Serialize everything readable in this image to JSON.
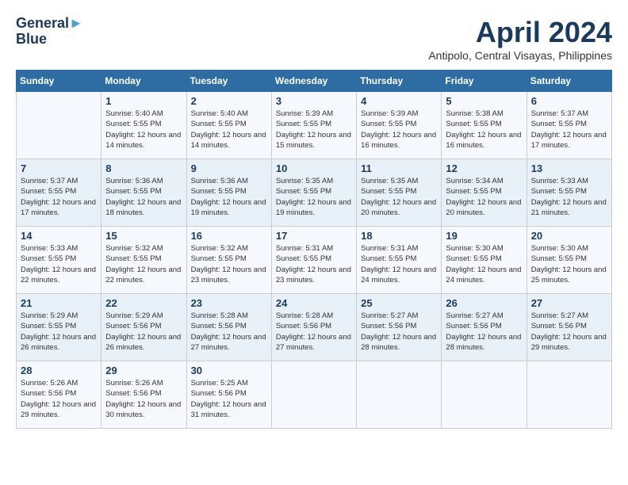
{
  "header": {
    "logo_line1": "General",
    "logo_line2": "Blue",
    "month_title": "April 2024",
    "subtitle": "Antipolo, Central Visayas, Philippines"
  },
  "calendar": {
    "days_of_week": [
      "Sunday",
      "Monday",
      "Tuesday",
      "Wednesday",
      "Thursday",
      "Friday",
      "Saturday"
    ],
    "weeks": [
      [
        {
          "day": "",
          "sunrise": "",
          "sunset": "",
          "daylight": ""
        },
        {
          "day": "1",
          "sunrise": "Sunrise: 5:40 AM",
          "sunset": "Sunset: 5:55 PM",
          "daylight": "Daylight: 12 hours and 14 minutes."
        },
        {
          "day": "2",
          "sunrise": "Sunrise: 5:40 AM",
          "sunset": "Sunset: 5:55 PM",
          "daylight": "Daylight: 12 hours and 14 minutes."
        },
        {
          "day": "3",
          "sunrise": "Sunrise: 5:39 AM",
          "sunset": "Sunset: 5:55 PM",
          "daylight": "Daylight: 12 hours and 15 minutes."
        },
        {
          "day": "4",
          "sunrise": "Sunrise: 5:39 AM",
          "sunset": "Sunset: 5:55 PM",
          "daylight": "Daylight: 12 hours and 16 minutes."
        },
        {
          "day": "5",
          "sunrise": "Sunrise: 5:38 AM",
          "sunset": "Sunset: 5:55 PM",
          "daylight": "Daylight: 12 hours and 16 minutes."
        },
        {
          "day": "6",
          "sunrise": "Sunrise: 5:37 AM",
          "sunset": "Sunset: 5:55 PM",
          "daylight": "Daylight: 12 hours and 17 minutes."
        }
      ],
      [
        {
          "day": "7",
          "sunrise": "Sunrise: 5:37 AM",
          "sunset": "Sunset: 5:55 PM",
          "daylight": "Daylight: 12 hours and 17 minutes."
        },
        {
          "day": "8",
          "sunrise": "Sunrise: 5:36 AM",
          "sunset": "Sunset: 5:55 PM",
          "daylight": "Daylight: 12 hours and 18 minutes."
        },
        {
          "day": "9",
          "sunrise": "Sunrise: 5:36 AM",
          "sunset": "Sunset: 5:55 PM",
          "daylight": "Daylight: 12 hours and 19 minutes."
        },
        {
          "day": "10",
          "sunrise": "Sunrise: 5:35 AM",
          "sunset": "Sunset: 5:55 PM",
          "daylight": "Daylight: 12 hours and 19 minutes."
        },
        {
          "day": "11",
          "sunrise": "Sunrise: 5:35 AM",
          "sunset": "Sunset: 5:55 PM",
          "daylight": "Daylight: 12 hours and 20 minutes."
        },
        {
          "day": "12",
          "sunrise": "Sunrise: 5:34 AM",
          "sunset": "Sunset: 5:55 PM",
          "daylight": "Daylight: 12 hours and 20 minutes."
        },
        {
          "day": "13",
          "sunrise": "Sunrise: 5:33 AM",
          "sunset": "Sunset: 5:55 PM",
          "daylight": "Daylight: 12 hours and 21 minutes."
        }
      ],
      [
        {
          "day": "14",
          "sunrise": "Sunrise: 5:33 AM",
          "sunset": "Sunset: 5:55 PM",
          "daylight": "Daylight: 12 hours and 22 minutes."
        },
        {
          "day": "15",
          "sunrise": "Sunrise: 5:32 AM",
          "sunset": "Sunset: 5:55 PM",
          "daylight": "Daylight: 12 hours and 22 minutes."
        },
        {
          "day": "16",
          "sunrise": "Sunrise: 5:32 AM",
          "sunset": "Sunset: 5:55 PM",
          "daylight": "Daylight: 12 hours and 23 minutes."
        },
        {
          "day": "17",
          "sunrise": "Sunrise: 5:31 AM",
          "sunset": "Sunset: 5:55 PM",
          "daylight": "Daylight: 12 hours and 23 minutes."
        },
        {
          "day": "18",
          "sunrise": "Sunrise: 5:31 AM",
          "sunset": "Sunset: 5:55 PM",
          "daylight": "Daylight: 12 hours and 24 minutes."
        },
        {
          "day": "19",
          "sunrise": "Sunrise: 5:30 AM",
          "sunset": "Sunset: 5:55 PM",
          "daylight": "Daylight: 12 hours and 24 minutes."
        },
        {
          "day": "20",
          "sunrise": "Sunrise: 5:30 AM",
          "sunset": "Sunset: 5:55 PM",
          "daylight": "Daylight: 12 hours and 25 minutes."
        }
      ],
      [
        {
          "day": "21",
          "sunrise": "Sunrise: 5:29 AM",
          "sunset": "Sunset: 5:55 PM",
          "daylight": "Daylight: 12 hours and 26 minutes."
        },
        {
          "day": "22",
          "sunrise": "Sunrise: 5:29 AM",
          "sunset": "Sunset: 5:56 PM",
          "daylight": "Daylight: 12 hours and 26 minutes."
        },
        {
          "day": "23",
          "sunrise": "Sunrise: 5:28 AM",
          "sunset": "Sunset: 5:56 PM",
          "daylight": "Daylight: 12 hours and 27 minutes."
        },
        {
          "day": "24",
          "sunrise": "Sunrise: 5:28 AM",
          "sunset": "Sunset: 5:56 PM",
          "daylight": "Daylight: 12 hours and 27 minutes."
        },
        {
          "day": "25",
          "sunrise": "Sunrise: 5:27 AM",
          "sunset": "Sunset: 5:56 PM",
          "daylight": "Daylight: 12 hours and 28 minutes."
        },
        {
          "day": "26",
          "sunrise": "Sunrise: 5:27 AM",
          "sunset": "Sunset: 5:56 PM",
          "daylight": "Daylight: 12 hours and 28 minutes."
        },
        {
          "day": "27",
          "sunrise": "Sunrise: 5:27 AM",
          "sunset": "Sunset: 5:56 PM",
          "daylight": "Daylight: 12 hours and 29 minutes."
        }
      ],
      [
        {
          "day": "28",
          "sunrise": "Sunrise: 5:26 AM",
          "sunset": "Sunset: 5:56 PM",
          "daylight": "Daylight: 12 hours and 29 minutes."
        },
        {
          "day": "29",
          "sunrise": "Sunrise: 5:26 AM",
          "sunset": "Sunset: 5:56 PM",
          "daylight": "Daylight: 12 hours and 30 minutes."
        },
        {
          "day": "30",
          "sunrise": "Sunrise: 5:25 AM",
          "sunset": "Sunset: 5:56 PM",
          "daylight": "Daylight: 12 hours and 31 minutes."
        },
        {
          "day": "",
          "sunrise": "",
          "sunset": "",
          "daylight": ""
        },
        {
          "day": "",
          "sunrise": "",
          "sunset": "",
          "daylight": ""
        },
        {
          "day": "",
          "sunrise": "",
          "sunset": "",
          "daylight": ""
        },
        {
          "day": "",
          "sunrise": "",
          "sunset": "",
          "daylight": ""
        }
      ]
    ]
  }
}
